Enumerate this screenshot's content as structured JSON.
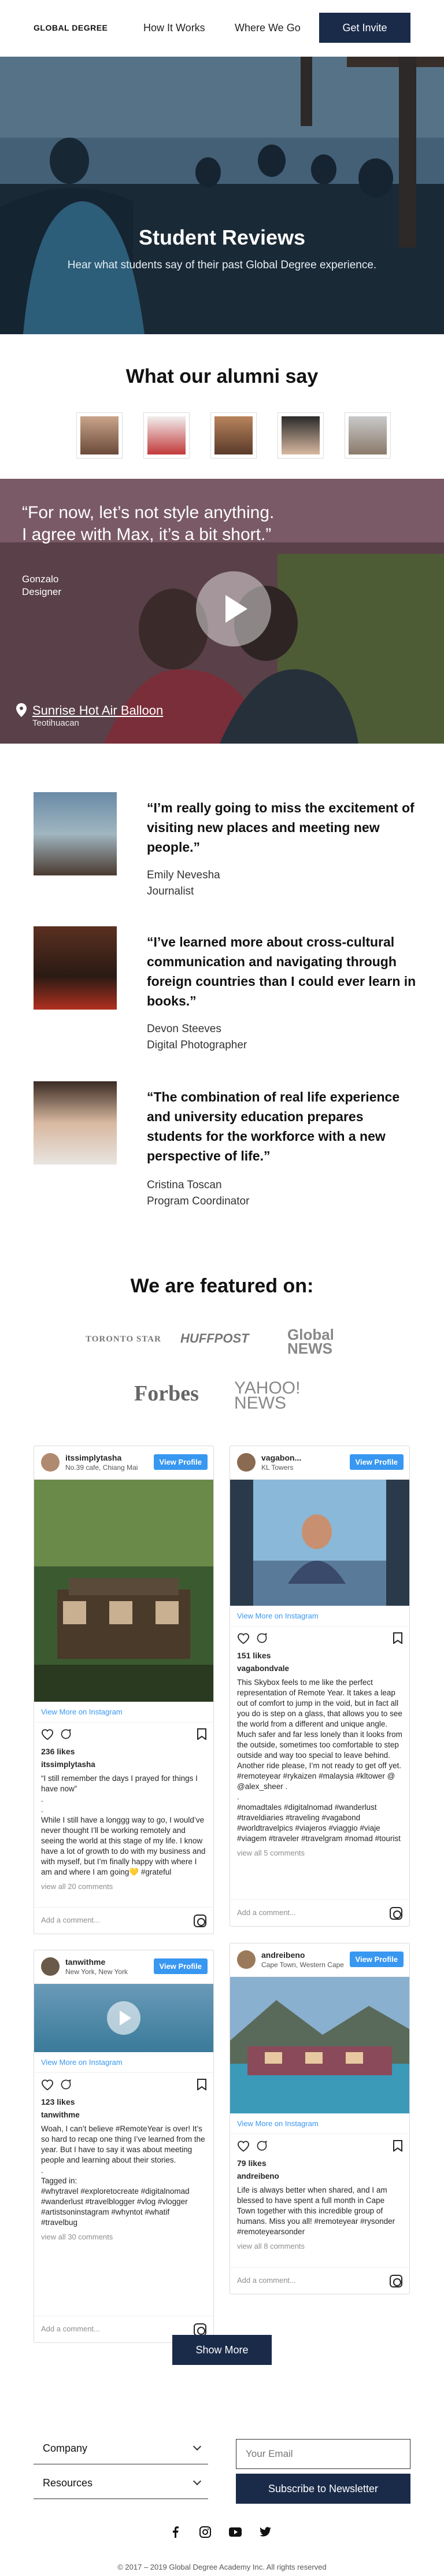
{
  "nav": {
    "logo": "GLOBAL DEGREE",
    "links": [
      "How It Works",
      "Where We Go"
    ],
    "cta": "Get Invite"
  },
  "hero": {
    "title": "Student Reviews",
    "subtitle": "Hear what students say of their past Global Degree experience."
  },
  "alumni": {
    "title": "What our alumni say"
  },
  "video": {
    "quote": "“For now, let’s not style anything. I agree with Max, it’s a bit short.”",
    "name": "Gonzalo",
    "role": "Designer",
    "location": "Sunrise Hot Air Balloon",
    "place": "Teotihuacan"
  },
  "testimonials": [
    {
      "quote": "“I’m really going to miss the excitement of visiting new places and meeting new people.”",
      "name": "Emily Nevesha",
      "role": "Journalist"
    },
    {
      "quote": "“I’ve learned more about cross-cultural communication and navigating through foreign countries than I could ever learn in books.”",
      "name": "Devon Steeves",
      "role": "Digital Photographer"
    },
    {
      "quote": "“The combination of real life experience and university education prepares students for the workforce with a new perspective of life.”",
      "name": "Cristina Toscan",
      "role": "Program Coordinator"
    }
  ],
  "featured": {
    "title": "We are featured on:",
    "logos": [
      "TORONTO STAR",
      "HUFFPOST",
      "Global NEWS",
      "Forbes",
      "YAHOO! NEWS"
    ]
  },
  "instagram": [
    {
      "user": "itssimplytasha",
      "loc": "No.39 cafe, Chiang Mai",
      "btn": "View Profile",
      "link": "View More on Instagram",
      "likes": "236 likes",
      "caption_user": "itssimplytasha",
      "caption": "“I still remember the days I prayed for things I have now”\n.\n.\nWhile I still have a longgg way to go, I would’ve never thought I’ll be working remotely and seeing the world at this stage of my life. I know have a lot of growth to do with my business and with myself, but I’m finally happy with where I am and where I am going💛 #grateful",
      "comments": "view all 20 comments",
      "add": "Add a comment..."
    },
    {
      "user": "vagabon...",
      "loc": "KL Towers",
      "btn": "View Profile",
      "link": "View More on Instagram",
      "likes": "151 likes",
      "caption_user": "vagabondvale",
      "caption": "This Skybox feels to me like the perfect representation of Remote Year. It takes a leap out of comfort to jump in the void, but in fact all you do is step on a glass, that allows you to see the world from a different and unique angle. Much safer and far less lonely than it looks from the outside, sometimes too comfortable to step outside and way too special to leave behind.\nAnother ride please, I’m not ready to get off yet.\n#remoteyear #rykaizen #malaysia #kltower @ @alex_sheer .\n.\n#nomadtales #digitalnomad #wanderlust #traveldiaries #traveling #vagabond #worldtravelpics #viajeros #viaggio #viaje #viagem #traveler #travelgram #nomad #tourist",
      "comments": "view all 5 comments",
      "add": "Add a comment..."
    },
    {
      "user": "tanwithme",
      "loc": "New York, New York",
      "btn": "View Profile",
      "link": "View More on Instagram",
      "likes": "123 likes",
      "caption_user": "tanwithme",
      "caption": "Woah, I can’t believe #RemoteYear is over! It’s so hard to recap one thing I’ve learned from the year. But I have to say it was about meeting people and learning about their stories.\n.\nTagged in:\n#whytravel #exploretocreate #digitalnomad #wanderlust #travelblogger #vlog #vlogger #artistsoninstagram #whyntot #whatif #travelbug",
      "comments": "view all 30 comments",
      "add": "Add a comment..."
    },
    {
      "user": "andreibeno",
      "loc": "Cape Town, Western Cape",
      "btn": "View Profile",
      "link": "View More on Instagram",
      "likes": "79 likes",
      "caption_user": "andreibeno",
      "caption": "Life is always better when shared, and I am blessed to have spent a full month in Cape Town together with this incredible group of humans. Miss you all! #remoteyear #rysonder #remoteyearsonder",
      "comments": "view all 8 comments",
      "add": "Add a comment..."
    }
  ],
  "show_more": "Show More",
  "footer": {
    "accordions": [
      "Company",
      "Resources"
    ],
    "email_placeholder": "Your Email",
    "subscribe": "Subscribe to Newsletter",
    "social": [
      "facebook-icon",
      "instagram-icon",
      "youtube-icon",
      "twitter-icon"
    ],
    "copyright": "© 2017 – 2019 Global Degree Academy Inc. All rights reserved"
  },
  "colors": {
    "navy": "#1a2b4a",
    "ig_blue": "#3897f0"
  }
}
